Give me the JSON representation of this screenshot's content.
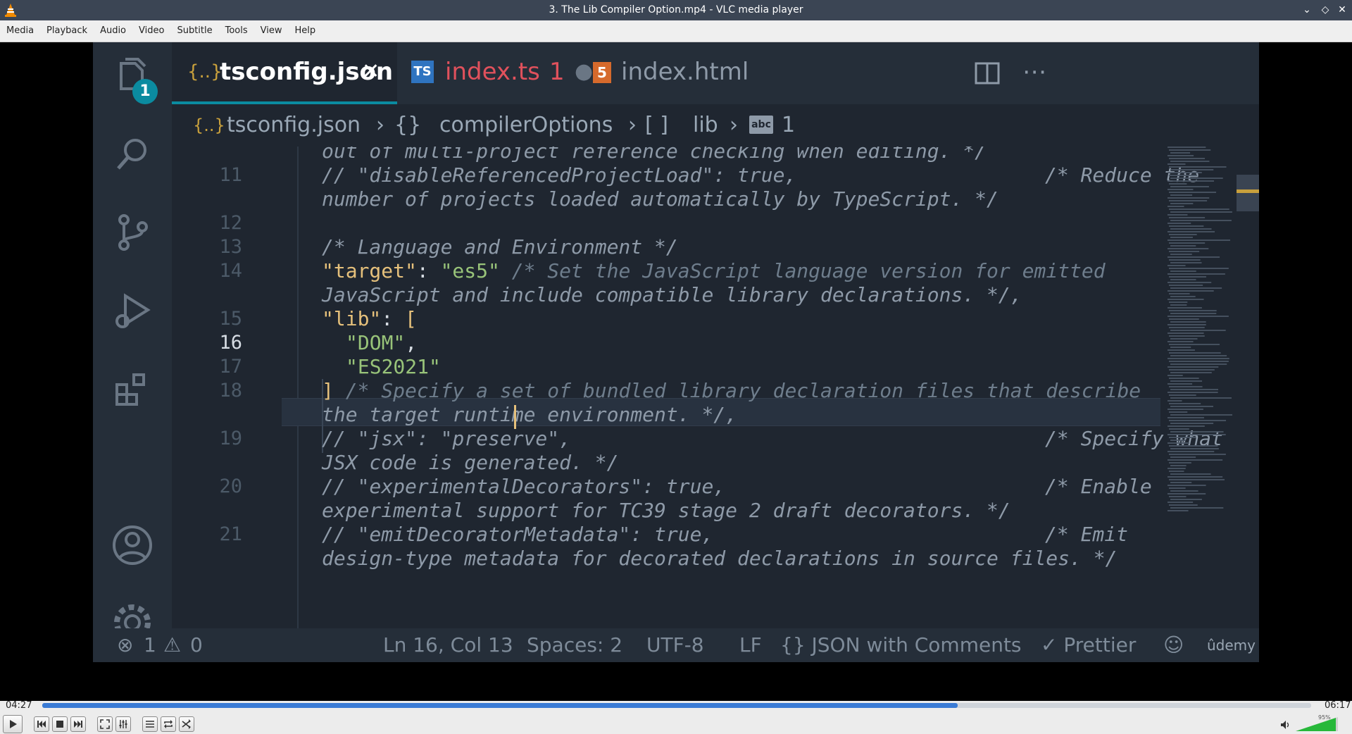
{
  "window": {
    "title": "3. The Lib Compiler Option.mp4 - VLC media player"
  },
  "menu": [
    "Media",
    "Playback",
    "Audio",
    "Video",
    "Subtitle",
    "Tools",
    "View",
    "Help"
  ],
  "editor": {
    "explorer_badge": "1",
    "tabs": [
      {
        "icon": "{..}",
        "label": "tsconfig.json",
        "close": "✕"
      },
      {
        "icon": "TS",
        "label": "index.ts",
        "problem_count": "1",
        "dirty": "●"
      },
      {
        "icon": "5",
        "label": "index.html"
      }
    ],
    "breadcrumb": {
      "file": "tsconfig.json",
      "obj": "compilerOptions",
      "arr": "lib",
      "item": "1"
    },
    "line_numbers": [
      "11",
      "12",
      "13",
      "14",
      "15",
      "16",
      "17",
      "18",
      "19",
      "20",
      "21"
    ],
    "code": {
      "l0": "out of multi-project reference checking when editing. */",
      "l11a": "// \"disableReferencedProjectLoad\": true,",
      "l11b": "/* Reduce the",
      "l11c": "number of projects loaded automatically by TypeScript. */",
      "l13": "/* Language and Environment */",
      "l14key": "\"target\"",
      "l14colon": ": ",
      "l14val": "\"es5\"",
      "l14cm": " /* Set the JavaScript language version for emitted",
      "l14b": "JavaScript and include compatible library declarations. */,",
      "l15key": "\"lib\"",
      "l15colon": ": ",
      "l15brk": "[",
      "l16str": "\"DOM\"",
      "l16comma": ",",
      "l17str": "\"ES2021\"",
      "l18brk": "]",
      "l18cm": " /* Specify a set of bundled library declaration files that describe",
      "l18b": "the target runtime environment. */,",
      "l19a": "// \"jsx\": \"preserve\",",
      "l19b": "/* Specify what",
      "l19c": "JSX code is generated. */",
      "l20a": "// \"experimentalDecorators\": true,",
      "l20b": "/* Enable",
      "l20c": "experimental support for TC39 stage 2 draft decorators. */",
      "l21a": "// \"emitDecoratorMetadata\": true,",
      "l21b": "/* Emit",
      "l21c": "design-type metadata for decorated declarations in source files. */"
    },
    "status": {
      "errors": "1",
      "warnings": "0",
      "position": "Ln 16, Col 13",
      "spaces": "Spaces: 2",
      "encoding": "UTF-8",
      "eol": "LF",
      "language": "{} JSON with Comments",
      "formatter": "✓ Prettier",
      "watermark": "ûdemy"
    }
  },
  "player": {
    "time_current": "04:27",
    "time_total": "06:17",
    "progress": 0.7215,
    "volume_label": "95%",
    "volume": 0.95
  },
  "colors": {
    "accent": "#0b8ba0",
    "seek": "#3a7bd5",
    "volume": "#27b83a"
  }
}
